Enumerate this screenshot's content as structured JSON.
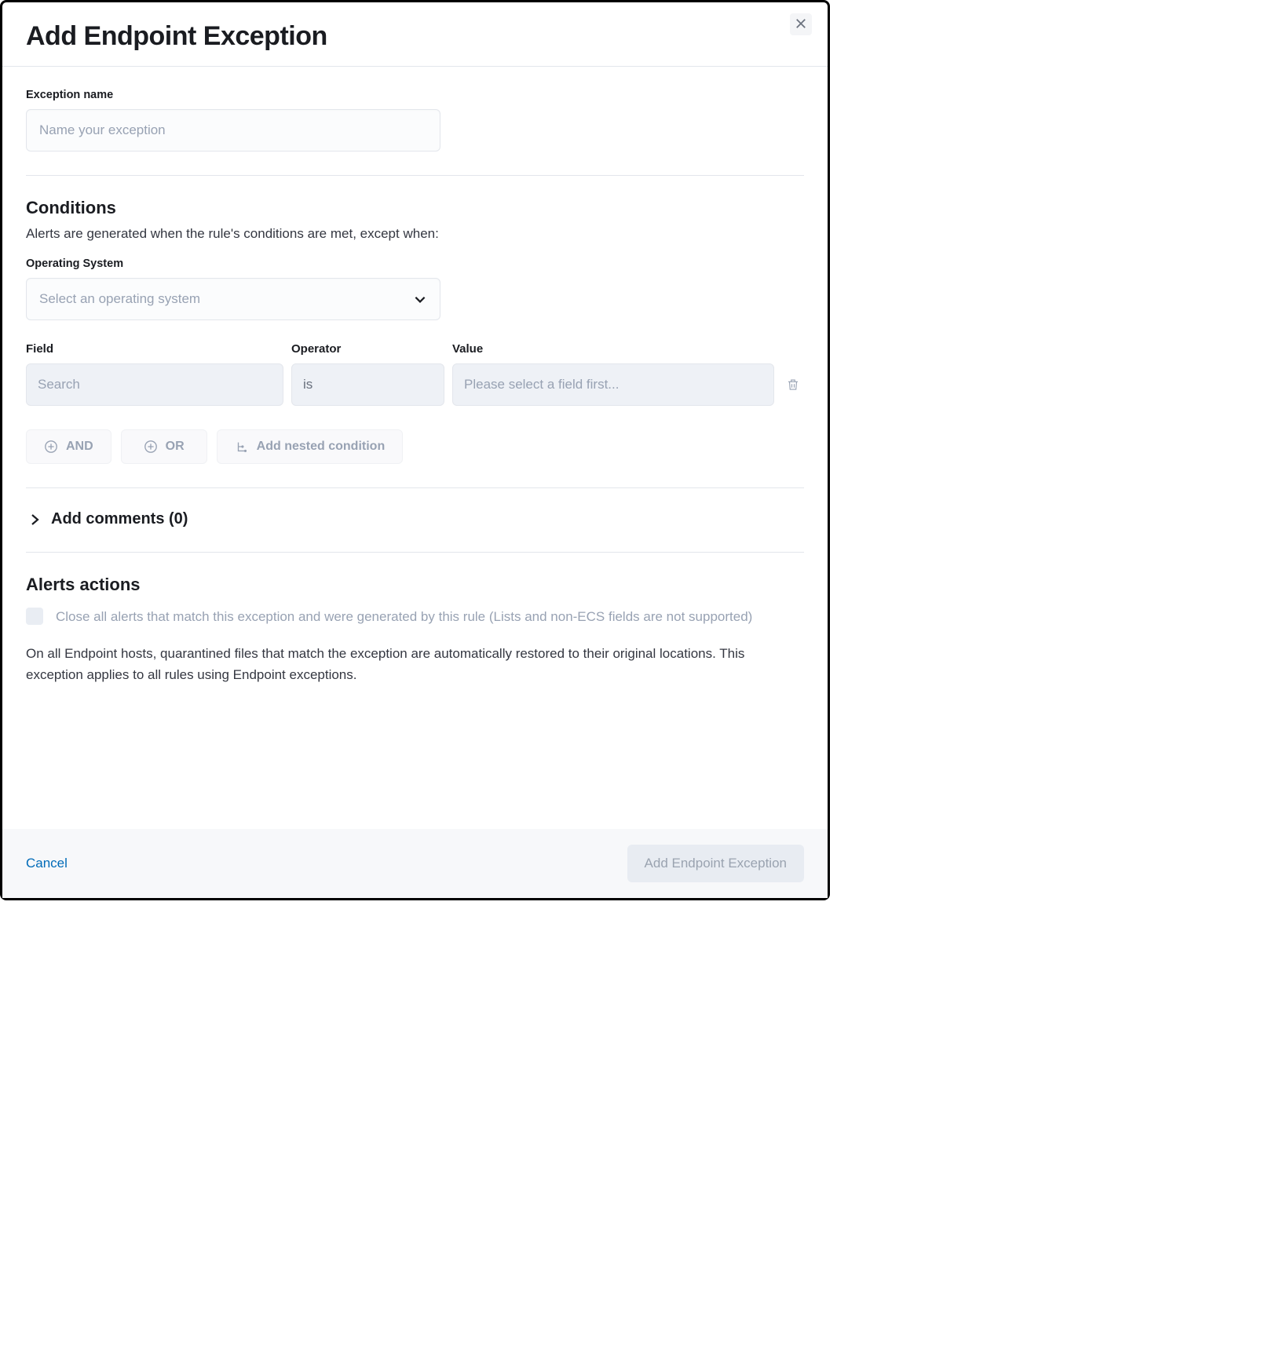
{
  "header": {
    "title": "Add Endpoint Exception"
  },
  "exception_name": {
    "label": "Exception name",
    "placeholder": "Name your exception",
    "value": ""
  },
  "conditions": {
    "title": "Conditions",
    "description": "Alerts are generated when the rule's conditions are met, except when:",
    "os": {
      "label": "Operating System",
      "placeholder": "Select an operating system"
    },
    "columns": {
      "field": "Field",
      "operator": "Operator",
      "value": "Value"
    },
    "row": {
      "field_placeholder": "Search",
      "operator_value": "is",
      "value_placeholder": "Please select a field first..."
    },
    "logic": {
      "and": "AND",
      "or": "OR",
      "nested": "Add nested condition"
    }
  },
  "comments": {
    "title": "Add comments (0)"
  },
  "alerts_actions": {
    "title": "Alerts actions",
    "close_alerts_label": "Close all alerts that match this exception and were generated by this rule (Lists and non-ECS fields are not supported)",
    "info": "On all Endpoint hosts, quarantined files that match the exception are automatically restored to their original locations. This exception applies to all rules using Endpoint exceptions."
  },
  "footer": {
    "cancel": "Cancel",
    "submit": "Add Endpoint Exception"
  }
}
